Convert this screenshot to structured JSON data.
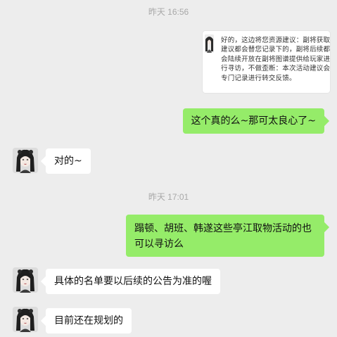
{
  "chat": {
    "timestamps": [
      "昨天 16:56",
      "昨天 17:01"
    ],
    "quoted_message": "好的，这边将您资源建议：副将获取建议都会替您记录下的，副将后续都会陆续开放在副将图谱提供给玩家进行寻访，不做歪断：本次活动建议会专门记录进行转交反馈。",
    "messages": [
      {
        "side": "out",
        "text": "这个真的么~那可太良心了~"
      },
      {
        "side": "in",
        "text": "对的~"
      },
      {
        "side": "out",
        "text": "蹋顿、胡班、韩遂这些亭江取物活动的也可以寻访么"
      },
      {
        "side": "in",
        "text": "具体的名单要以后续的公告为准的喔"
      },
      {
        "side": "in",
        "text": "目前还在规划的"
      }
    ]
  },
  "icons": {
    "contact_avatar": "woman-portrait-avatar",
    "quote_thumbnail": "portrait-thumbnail-icon"
  },
  "colors": {
    "background": "#ededed",
    "outgoing_bubble": "#95ec69",
    "incoming_bubble": "#ffffff",
    "timestamp": "#a8a8a8"
  }
}
